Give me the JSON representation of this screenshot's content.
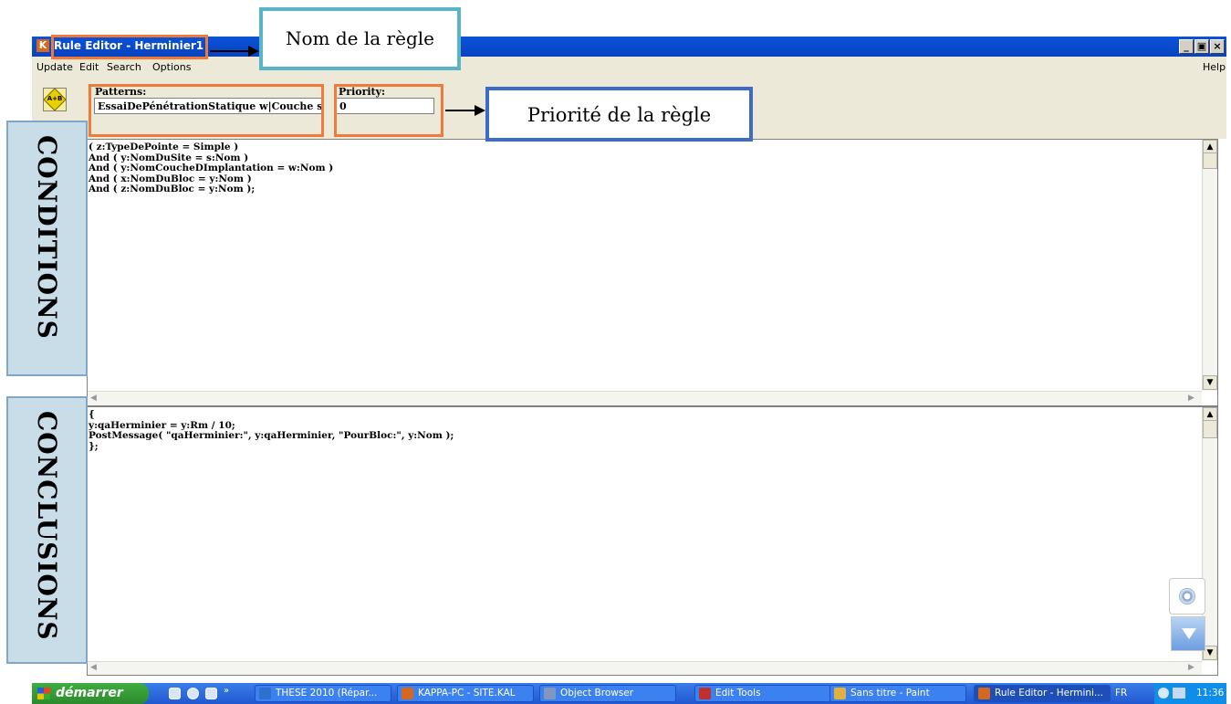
{
  "window": {
    "title": "Rule Editor - Herminier1",
    "app_icon": "K",
    "controls": [
      "_",
      "▣",
      "×"
    ]
  },
  "menu": {
    "items": [
      "Update",
      "Edit",
      "Search",
      "Options"
    ],
    "help": "Help"
  },
  "toolbar": {
    "rule_button_icon": "A+B",
    "patterns_label": "Patterns:",
    "patterns_value": "EssaiDePénétrationStatique w|Couche s|Site",
    "priority_label": "Priority:",
    "priority_value": "0"
  },
  "conditions_code": "( z:TypeDePointe = Simple )\nAnd ( y:NomDuSite = s:Nom )\nAnd ( y:NomCoucheDImplantation = w:Nom )\nAnd ( x:NomDuBloc = y:Nom )\nAnd ( z:NomDuBloc = y:Nom );",
  "conclusions_code": "{\ny:qaHerminier = y:Rm / 10;\nPostMessage( \"qaHerminier:\", y:qaHerminier, \"PourBloc:\", y:Nom );\n};",
  "annotations": {
    "rule_name": "Nom de la règle",
    "rule_priority": "Priorité de la règle",
    "conditions": "CONDITIONS",
    "conclusions": "CONCLUSIONS"
  },
  "taskbar": {
    "start": "démarrer",
    "tasks": [
      {
        "label": "THESE 2010 (Répar...",
        "icon_color": "#2f6fd0"
      },
      {
        "label": "KAPPA-PC - SITE.KAL",
        "icon_color": "#d2691e"
      },
      {
        "label": "Object Browser",
        "icon_color": "#8098c0"
      },
      {
        "label": "Edit Tools",
        "icon_color": "#c03030"
      },
      {
        "label": "Sans titre - Paint",
        "icon_color": "#e0b040"
      },
      {
        "label": "Rule Editor - Hermini...",
        "icon_color": "#d2691e"
      }
    ],
    "lang": "FR",
    "clock": "11:36"
  },
  "colors": {
    "titlebar": "#0a53d8",
    "annotation_orange": "#f07a3a",
    "callout_border_teal": "#5ab4c8",
    "callout_border_blue": "#3c6cc8",
    "side_label_fill": "#c9dde8"
  }
}
